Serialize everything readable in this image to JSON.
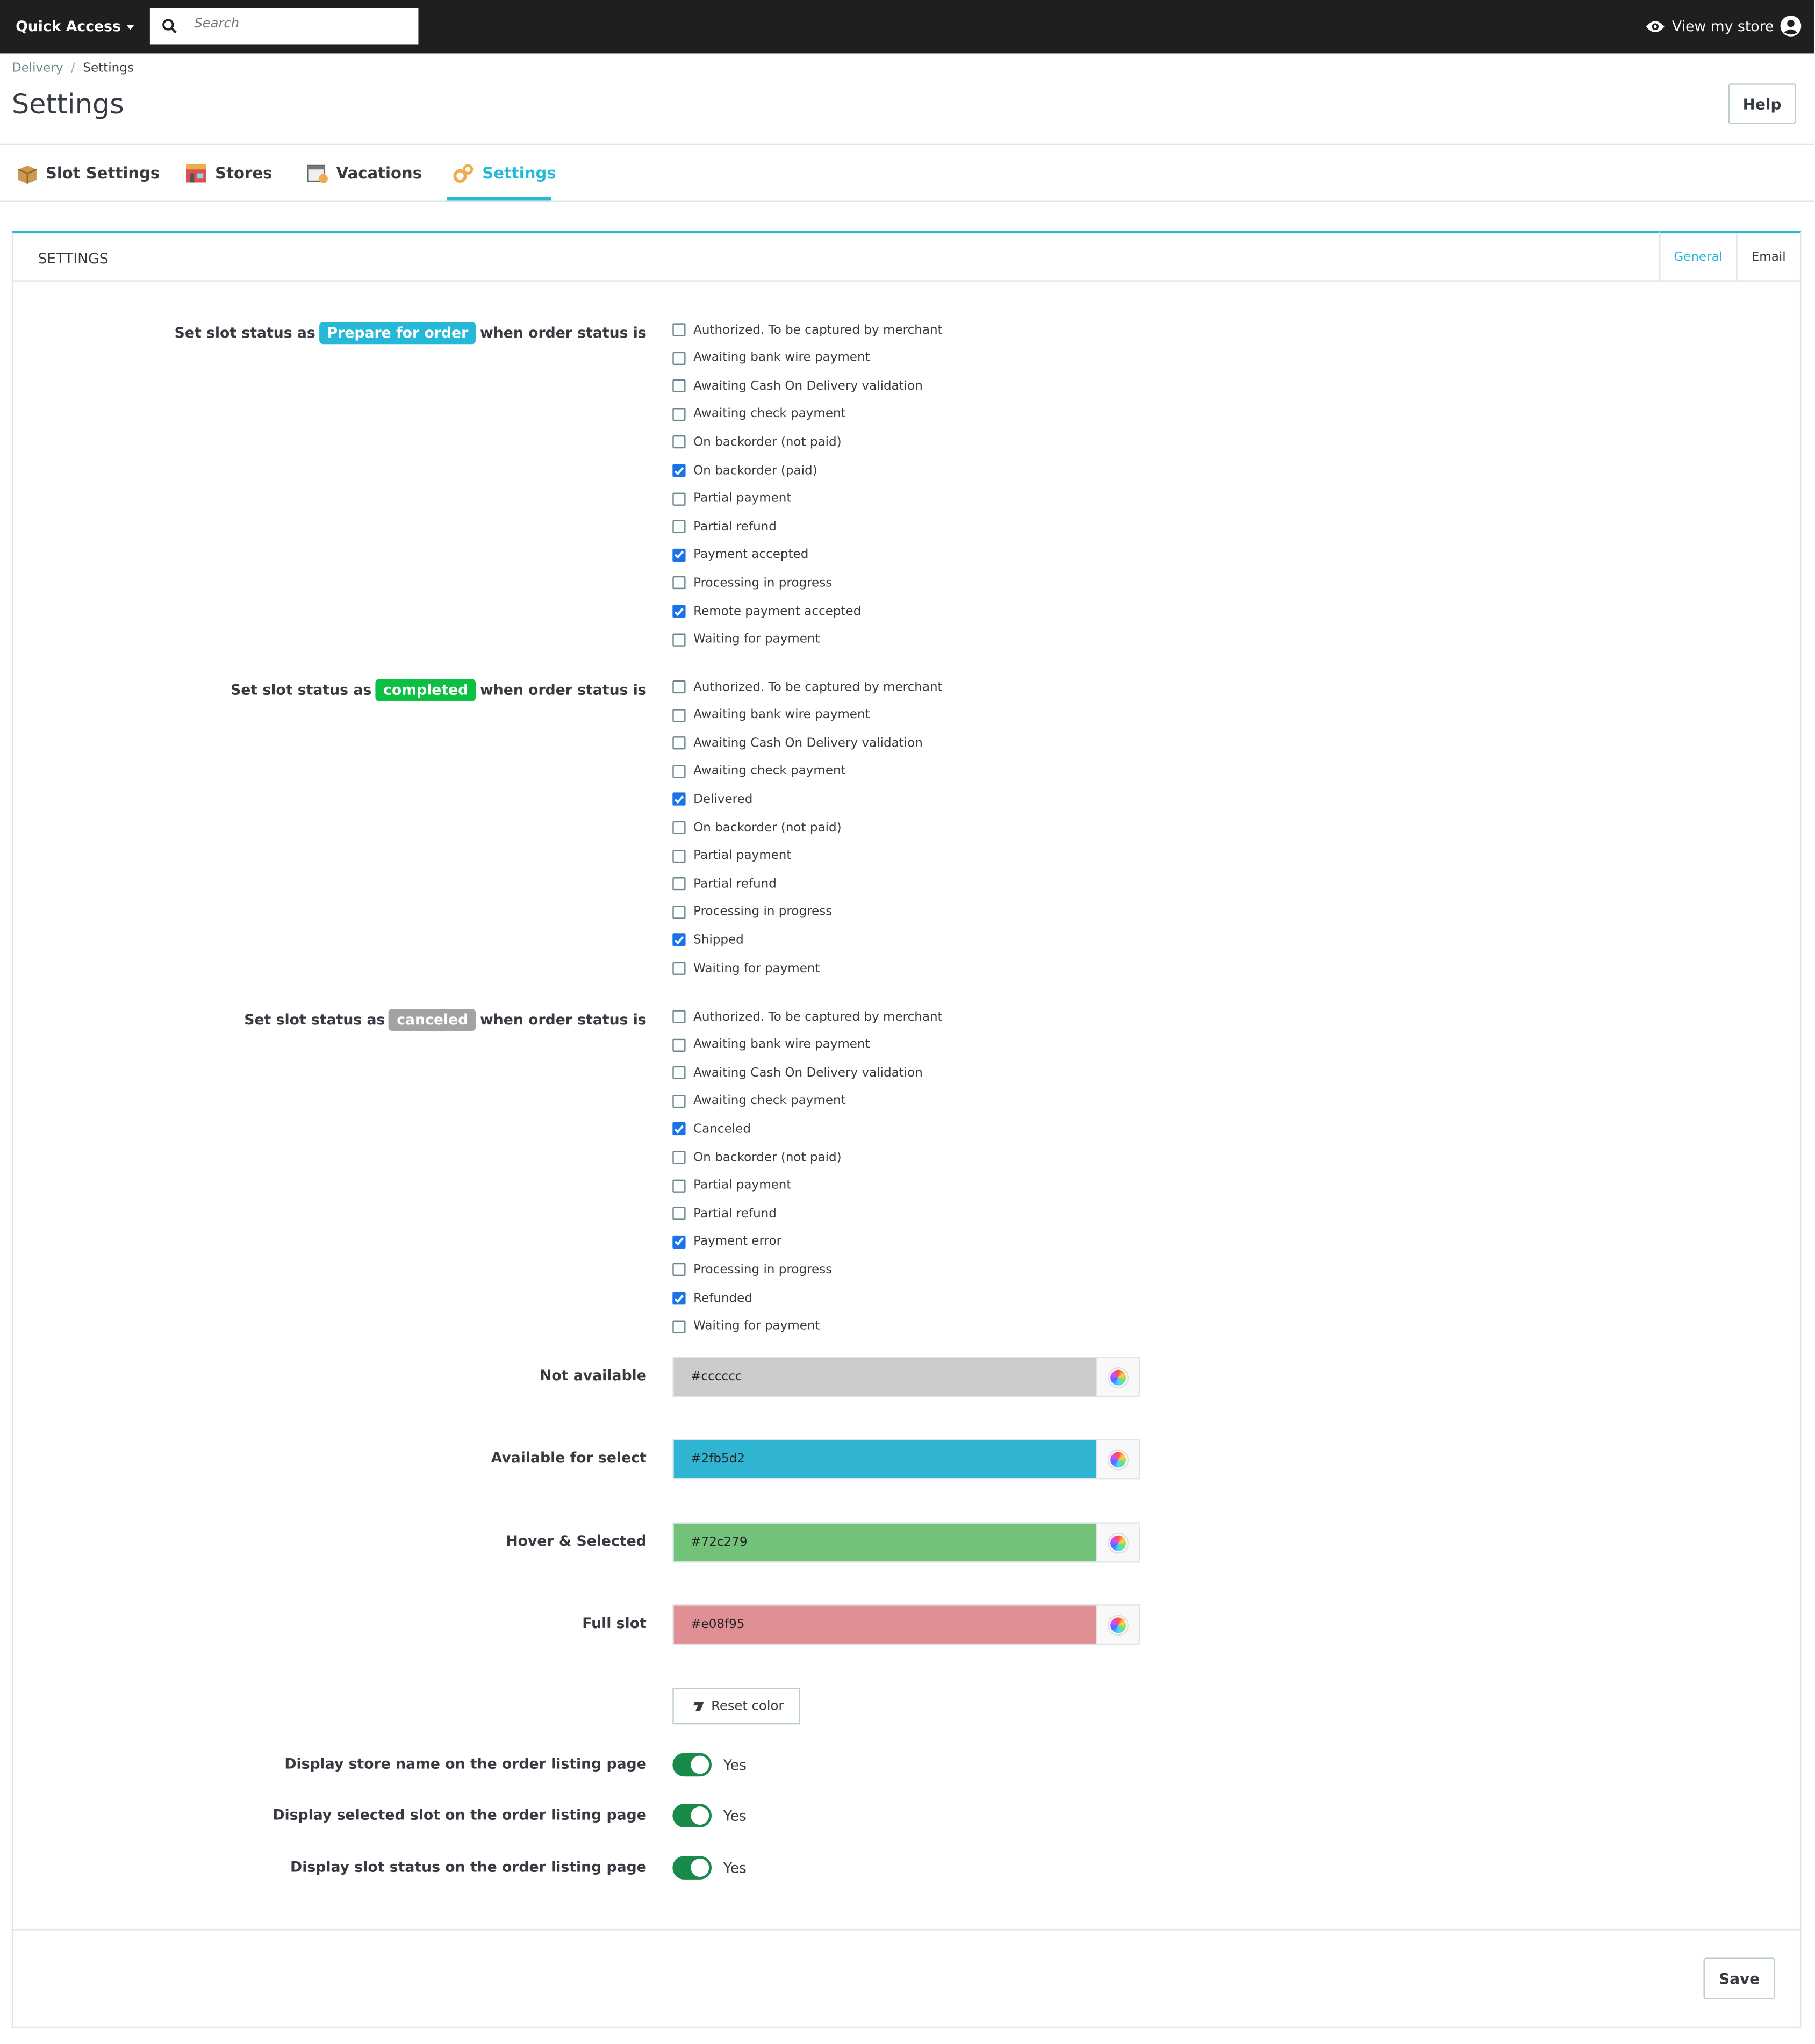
{
  "topbar": {
    "quick_access": "Quick Access",
    "search_placeholder": "Search",
    "view_store": "View my store"
  },
  "breadcrumb": {
    "parent": "Delivery",
    "separator": "/",
    "current": "Settings"
  },
  "page_title": "Settings",
  "help_label": "Help",
  "tabs": [
    {
      "label": "Slot Settings",
      "icon": "box-icon"
    },
    {
      "label": "Stores",
      "icon": "store-icon"
    },
    {
      "label": "Vacations",
      "icon": "calendar-icon"
    },
    {
      "label": "Settings",
      "icon": "gears-icon",
      "active": true
    }
  ],
  "panel": {
    "title": "SETTINGS",
    "tab_general": "General",
    "tab_email": "Email"
  },
  "rules": [
    {
      "prefix": "Set slot status as",
      "badge": "Prepare for order",
      "badge_color": "#25b9d7",
      "suffix": "when order status is",
      "options": [
        {
          "label": "Authorized. To be captured by merchant",
          "checked": false
        },
        {
          "label": "Awaiting bank wire payment",
          "checked": false
        },
        {
          "label": "Awaiting Cash On Delivery validation",
          "checked": false
        },
        {
          "label": "Awaiting check payment",
          "checked": false
        },
        {
          "label": "On backorder (not paid)",
          "checked": false
        },
        {
          "label": "On backorder (paid)",
          "checked": true
        },
        {
          "label": "Partial payment",
          "checked": false
        },
        {
          "label": "Partial refund",
          "checked": false
        },
        {
          "label": "Payment accepted",
          "checked": true
        },
        {
          "label": "Processing in progress",
          "checked": false
        },
        {
          "label": "Remote payment accepted",
          "checked": true
        },
        {
          "label": "Waiting for payment",
          "checked": false
        }
      ]
    },
    {
      "prefix": "Set slot status as",
      "badge": "completed",
      "badge_color": "#0bc042",
      "suffix": "when order status is",
      "options": [
        {
          "label": "Authorized. To be captured by merchant",
          "checked": false
        },
        {
          "label": "Awaiting bank wire payment",
          "checked": false
        },
        {
          "label": "Awaiting Cash On Delivery validation",
          "checked": false
        },
        {
          "label": "Awaiting check payment",
          "checked": false
        },
        {
          "label": "Delivered",
          "checked": true
        },
        {
          "label": "On backorder (not paid)",
          "checked": false
        },
        {
          "label": "Partial payment",
          "checked": false
        },
        {
          "label": "Partial refund",
          "checked": false
        },
        {
          "label": "Processing in progress",
          "checked": false
        },
        {
          "label": "Shipped",
          "checked": true
        },
        {
          "label": "Waiting for payment",
          "checked": false
        }
      ]
    },
    {
      "prefix": "Set slot status as",
      "badge": "canceled",
      "badge_color": "#a3a3a3",
      "suffix": "when order status is",
      "options": [
        {
          "label": "Authorized. To be captured by merchant",
          "checked": false
        },
        {
          "label": "Awaiting bank wire payment",
          "checked": false
        },
        {
          "label": "Awaiting Cash On Delivery validation",
          "checked": false
        },
        {
          "label": "Awaiting check payment",
          "checked": false
        },
        {
          "label": "Canceled",
          "checked": true
        },
        {
          "label": "On backorder (not paid)",
          "checked": false
        },
        {
          "label": "Partial payment",
          "checked": false
        },
        {
          "label": "Partial refund",
          "checked": false
        },
        {
          "label": "Payment error",
          "checked": true
        },
        {
          "label": "Processing in progress",
          "checked": false
        },
        {
          "label": "Refunded",
          "checked": true
        },
        {
          "label": "Waiting for payment",
          "checked": false
        }
      ]
    }
  ],
  "colors": [
    {
      "label": "Not available",
      "value": "#cccccc"
    },
    {
      "label": "Available for select",
      "value": "#2fb5d2"
    },
    {
      "label": "Hover & Selected",
      "value": "#72c279"
    },
    {
      "label": "Full slot",
      "value": "#e08f95"
    }
  ],
  "reset_color_label": "Reset color",
  "toggles": [
    {
      "label": "Display store name on the order listing page",
      "value": "Yes"
    },
    {
      "label": "Display selected slot on the order listing page",
      "value": "Yes"
    },
    {
      "label": "Display slot status on the order listing page",
      "value": "Yes"
    }
  ],
  "save_label": "Save"
}
